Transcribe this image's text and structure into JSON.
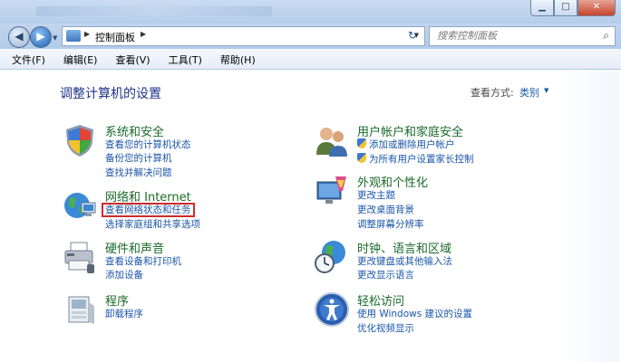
{
  "window": {
    "minimize_glyph": "▁",
    "maximize_glyph": "□",
    "close_glyph": "✕"
  },
  "address": {
    "back_glyph": "◀",
    "forward_glyph": "▶",
    "dropdown_glyph": "▼",
    "breadcrumb_sep": "▶",
    "breadcrumb": "控制面板",
    "refresh_glyph": "↻",
    "search_placeholder": "搜索控制面板",
    "search_glyph": "⌕"
  },
  "menu": [
    {
      "label": "文件(F)"
    },
    {
      "label": "编辑(E)"
    },
    {
      "label": "查看(V)"
    },
    {
      "label": "工具(T)"
    },
    {
      "label": "帮助(H)"
    }
  ],
  "main": {
    "heading": "调整计算机的设置",
    "view_by_label": "查看方式:",
    "view_by_value": "类别",
    "view_by_dropdown": "▼"
  },
  "categories": {
    "system": {
      "title": "系统和安全",
      "icon": "shield-icon",
      "links": [
        "查看您的计算机状态",
        "备份您的计算机",
        "查找并解决问题"
      ]
    },
    "network": {
      "title": "网络和 Internet",
      "icon": "network-globe-icon",
      "links": [
        "查看网络状态和任务",
        "选择家庭组和共享选项"
      ]
    },
    "hardware": {
      "title": "硬件和声音",
      "icon": "printer-icon",
      "links": [
        "查看设备和打印机",
        "添加设备"
      ]
    },
    "programs": {
      "title": "程序",
      "icon": "programs-box-icon",
      "links": [
        "卸载程序"
      ]
    },
    "users": {
      "title": "用户帐户和家庭安全",
      "icon": "users-icon",
      "links": [
        "添加或删除用户帐户",
        "为所有用户设置家长控制"
      ]
    },
    "appearance": {
      "title": "外观和个性化",
      "icon": "monitor-paint-icon",
      "links": [
        "更改主题",
        "更改桌面背景",
        "调整屏幕分辨率"
      ]
    },
    "clock": {
      "title": "时钟、语言和区域",
      "icon": "clock-globe-icon",
      "links": [
        "更改键盘或其他输入法",
        "更改显示语言"
      ]
    },
    "ease": {
      "title": "轻松访问",
      "icon": "ease-of-access-icon",
      "links": [
        "使用 Windows 建议的设置",
        "优化视频显示"
      ]
    }
  },
  "colors": {
    "category_title": "#1a6a2a",
    "link": "#1a55a8",
    "highlight": "#cf2b2b"
  }
}
